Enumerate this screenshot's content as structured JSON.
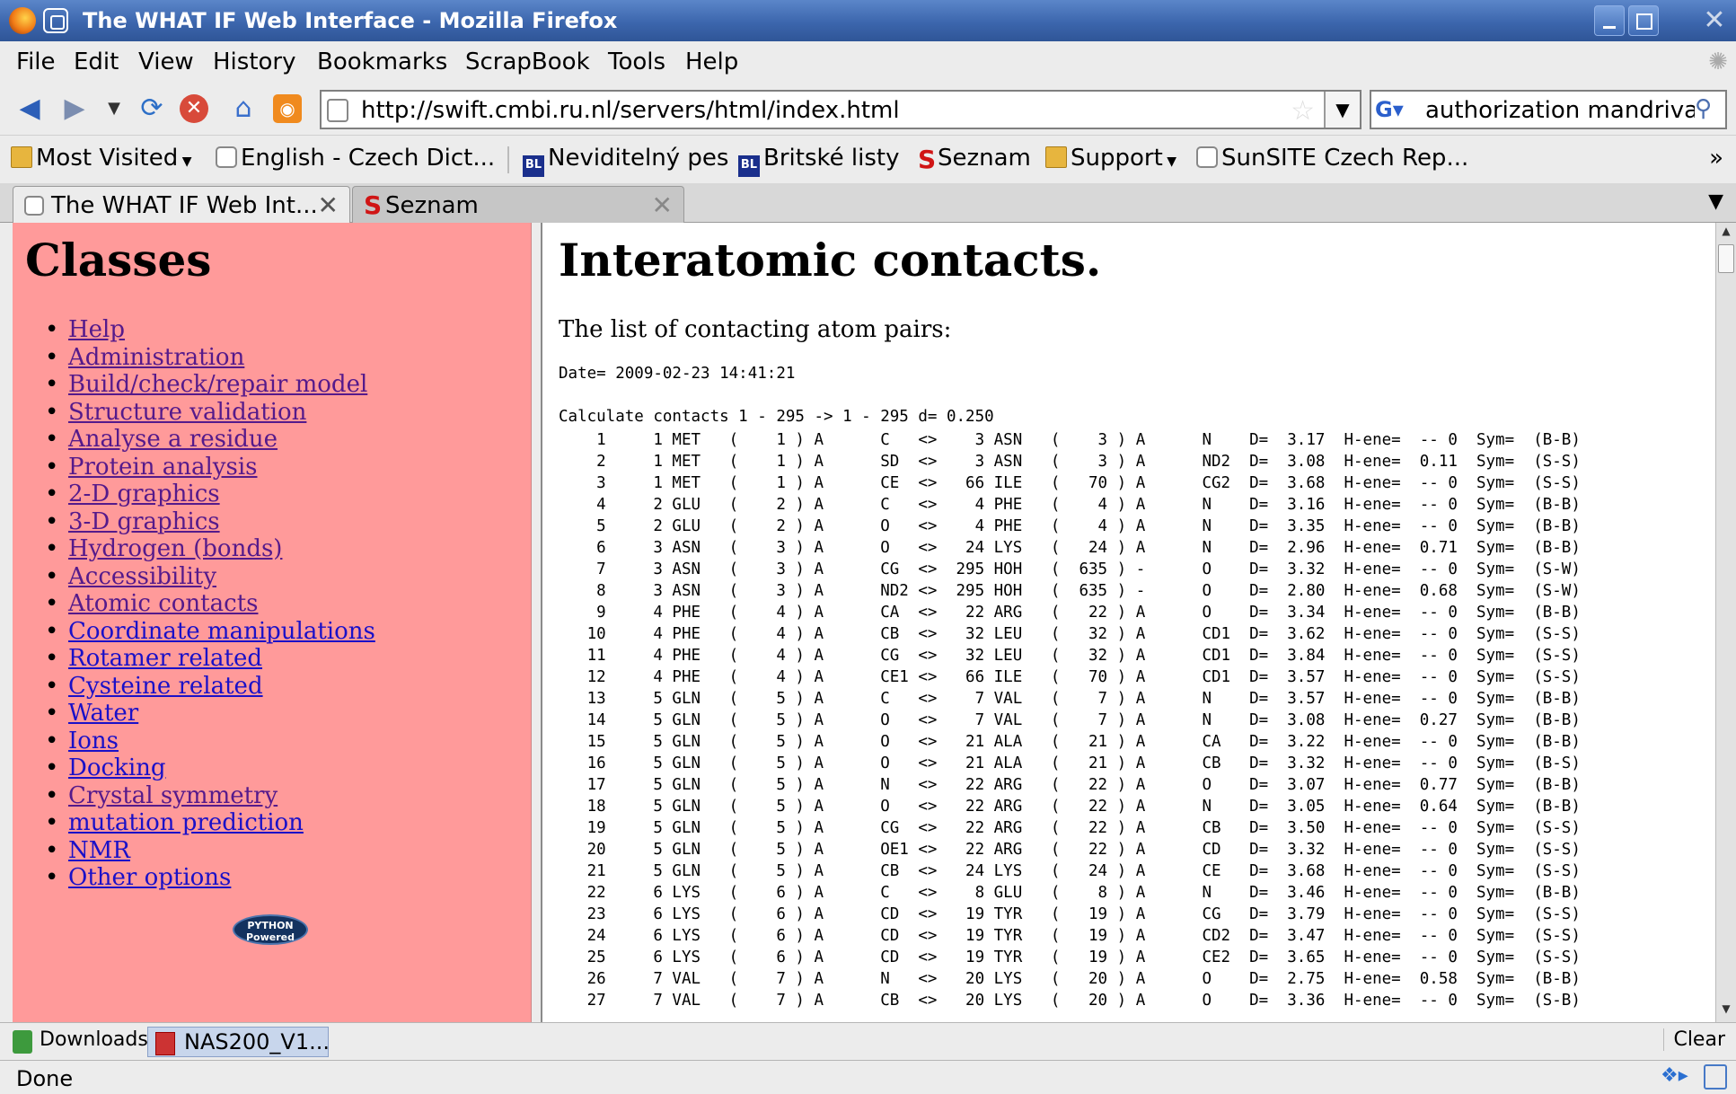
{
  "window": {
    "title": "The WHAT IF Web Interface - Mozilla Firefox"
  },
  "menu": [
    "File",
    "Edit",
    "View",
    "History",
    "Bookmarks",
    "ScrapBook",
    "Tools",
    "Help"
  ],
  "nav": {
    "url": "http://swift.cmbi.ru.nl/servers/html/index.html",
    "search_value": "authorization mandriva"
  },
  "bookmarks": [
    {
      "label": "Most Visited",
      "icon": "folder-icon"
    },
    {
      "label": "English - Czech Dict...",
      "icon": "page-icon"
    },
    {
      "label": "Neviditelný pes",
      "icon": "bl-icon"
    },
    {
      "label": "Britské listy",
      "icon": "bl-icon"
    },
    {
      "label": "Seznam",
      "icon": "seznam-icon"
    },
    {
      "label": "Support",
      "icon": "folder-icon"
    },
    {
      "label": "SunSITE Czech Rep...",
      "icon": "page-icon"
    }
  ],
  "tabs": [
    {
      "label": "The WHAT IF Web Int..."
    },
    {
      "label": "Seznam"
    }
  ],
  "left_frame": {
    "heading": "Classes",
    "items": [
      {
        "label": "Help",
        "visited": true
      },
      {
        "label": "Administration",
        "visited": true
      },
      {
        "label": "Build/check/repair model",
        "visited": true
      },
      {
        "label": "Structure validation",
        "visited": true
      },
      {
        "label": "Analyse a residue",
        "visited": true
      },
      {
        "label": "Protein analysis",
        "visited": true
      },
      {
        "label": "2-D graphics",
        "visited": true
      },
      {
        "label": "3-D graphics",
        "visited": true
      },
      {
        "label": "Hydrogen (bonds)",
        "visited": true
      },
      {
        "label": "Accessibility",
        "visited": true
      },
      {
        "label": "Atomic contacts",
        "visited": true
      },
      {
        "label": "Coordinate manipulations",
        "visited": false
      },
      {
        "label": "Rotamer related",
        "visited": false
      },
      {
        "label": "Cysteine related",
        "visited": false
      },
      {
        "label": "Water",
        "visited": false
      },
      {
        "label": "Ions",
        "visited": false
      },
      {
        "label": "Docking",
        "visited": false
      },
      {
        "label": "Crystal symmetry",
        "visited": true
      },
      {
        "label": "mutation prediction",
        "visited": false
      },
      {
        "label": "NMR",
        "visited": false
      },
      {
        "label": "Other options",
        "visited": false
      }
    ],
    "logo_text": "PYTHON Powered"
  },
  "right_frame": {
    "heading": "Interatomic contacts.",
    "intro": "The list of contacting atom pairs:",
    "date": "Date= 2009-02-23 14:41:21",
    "calc": "Calculate contacts 1 - 295 -> 1 - 295 d= 0.250",
    "contacts": [
      "    1     1 MET   (    1 ) A      C   <>    3 ASN   (    3 ) A      N    D=  3.17  H-ene=  -- 0  Sym=  (B-B)",
      "    2     1 MET   (    1 ) A      SD  <>    3 ASN   (    3 ) A      ND2  D=  3.08  H-ene=  0.11  Sym=  (S-S)",
      "    3     1 MET   (    1 ) A      CE  <>   66 ILE   (   70 ) A      CG2  D=  3.68  H-ene=  -- 0  Sym=  (S-S)",
      "    4     2 GLU   (    2 ) A      C   <>    4 PHE   (    4 ) A      N    D=  3.16  H-ene=  -- 0  Sym=  (B-B)",
      "    5     2 GLU   (    2 ) A      O   <>    4 PHE   (    4 ) A      N    D=  3.35  H-ene=  -- 0  Sym=  (B-B)",
      "    6     3 ASN   (    3 ) A      O   <>   24 LYS   (   24 ) A      N    D=  2.96  H-ene=  0.71  Sym=  (B-B)",
      "    7     3 ASN   (    3 ) A      CG  <>  295 HOH   (  635 ) -      O    D=  3.32  H-ene=  -- 0  Sym=  (S-W)",
      "    8     3 ASN   (    3 ) A      ND2 <>  295 HOH   (  635 ) -      O    D=  2.80  H-ene=  0.68  Sym=  (S-W)",
      "    9     4 PHE   (    4 ) A      CA  <>   22 ARG   (   22 ) A      O    D=  3.34  H-ene=  -- 0  Sym=  (B-B)",
      "   10     4 PHE   (    4 ) A      CB  <>   32 LEU   (   32 ) A      CD1  D=  3.62  H-ene=  -- 0  Sym=  (S-S)",
      "   11     4 PHE   (    4 ) A      CG  <>   32 LEU   (   32 ) A      CD1  D=  3.84  H-ene=  -- 0  Sym=  (S-S)",
      "   12     4 PHE   (    4 ) A      CE1 <>   66 ILE   (   70 ) A      CD1  D=  3.57  H-ene=  -- 0  Sym=  (S-S)",
      "   13     5 GLN   (    5 ) A      C   <>    7 VAL   (    7 ) A      N    D=  3.57  H-ene=  -- 0  Sym=  (B-B)",
      "   14     5 GLN   (    5 ) A      O   <>    7 VAL   (    7 ) A      N    D=  3.08  H-ene=  0.27  Sym=  (B-B)",
      "   15     5 GLN   (    5 ) A      O   <>   21 ALA   (   21 ) A      CA   D=  3.22  H-ene=  -- 0  Sym=  (B-B)",
      "   16     5 GLN   (    5 ) A      O   <>   21 ALA   (   21 ) A      CB   D=  3.32  H-ene=  -- 0  Sym=  (B-S)",
      "   17     5 GLN   (    5 ) A      N   <>   22 ARG   (   22 ) A      O    D=  3.07  H-ene=  0.77  Sym=  (B-B)",
      "   18     5 GLN   (    5 ) A      O   <>   22 ARG   (   22 ) A      N    D=  3.05  H-ene=  0.64  Sym=  (B-B)",
      "   19     5 GLN   (    5 ) A      CG  <>   22 ARG   (   22 ) A      CB   D=  3.50  H-ene=  -- 0  Sym=  (S-S)",
      "   20     5 GLN   (    5 ) A      OE1 <>   22 ARG   (   22 ) A      CD   D=  3.32  H-ene=  -- 0  Sym=  (S-S)",
      "   21     5 GLN   (    5 ) A      CB  <>   24 LYS   (   24 ) A      CE   D=  3.68  H-ene=  -- 0  Sym=  (S-S)",
      "   22     6 LYS   (    6 ) A      C   <>    8 GLU   (    8 ) A      N    D=  3.46  H-ene=  -- 0  Sym=  (B-B)",
      "   23     6 LYS   (    6 ) A      CD  <>   19 TYR   (   19 ) A      CG   D=  3.79  H-ene=  -- 0  Sym=  (S-S)",
      "   24     6 LYS   (    6 ) A      CD  <>   19 TYR   (   19 ) A      CD2  D=  3.47  H-ene=  -- 0  Sym=  (S-S)",
      "   25     6 LYS   (    6 ) A      CD  <>   19 TYR   (   19 ) A      CE2  D=  3.65  H-ene=  -- 0  Sym=  (S-S)",
      "   26     7 VAL   (    7 ) A      N   <>   20 LYS   (   20 ) A      O    D=  2.75  H-ene=  0.58  Sym=  (B-B)",
      "   27     7 VAL   (    7 ) A      CB  <>   20 LYS   (   20 ) A      O    D=  3.36  H-ene=  -- 0  Sym=  (S-B)"
    ]
  },
  "downloads": {
    "label": "Downloads",
    "item": "NAS200_V1...",
    "clear": "Clear"
  },
  "status": {
    "text": "Done"
  }
}
